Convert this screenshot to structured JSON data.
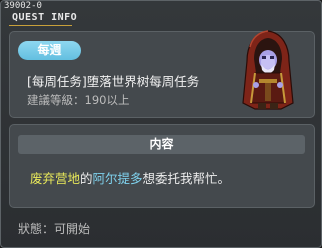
{
  "window": {
    "id_label": "39002-0",
    "title": "QUEST INFO"
  },
  "quest": {
    "badge": "每週",
    "name": "[每周任务]堕落世界树每周任务",
    "level_requirement": "建議等級：190以上",
    "npc_icon": "hooded-red-cloak-npc-icon"
  },
  "content": {
    "header": "内容",
    "segments": [
      {
        "text": "废弃营地",
        "style": "yellow"
      },
      {
        "text": "的",
        "style": "normal"
      },
      {
        "text": "阿尔提多",
        "style": "cyan"
      },
      {
        "text": "想委托我帮忙。",
        "style": "normal"
      }
    ]
  },
  "status": {
    "text": "狀態：可開始"
  },
  "colors": {
    "badge": "#74c9e8",
    "highlight_place": "#e9e95a",
    "highlight_npc": "#7fd2ee",
    "title_underline": "#c8a03a"
  }
}
